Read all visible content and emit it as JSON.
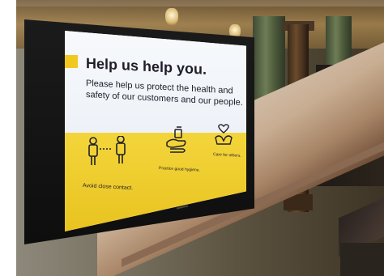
{
  "sign": {
    "headline": "Help us help you.",
    "subtext": "Please help us protect the health and safety of our customers and our people.",
    "icons": [
      {
        "name": "distance-people-icon",
        "caption": "Avoid close contact."
      },
      {
        "name": "hand-wash-icon",
        "caption": "Practice good hygiene."
      },
      {
        "name": "heart-hands-icon",
        "caption": "Care for others."
      }
    ]
  },
  "colors": {
    "accent": "#f0c81e",
    "panel_yellow": "#f3d53b",
    "text_dark": "#1e1e2a"
  }
}
